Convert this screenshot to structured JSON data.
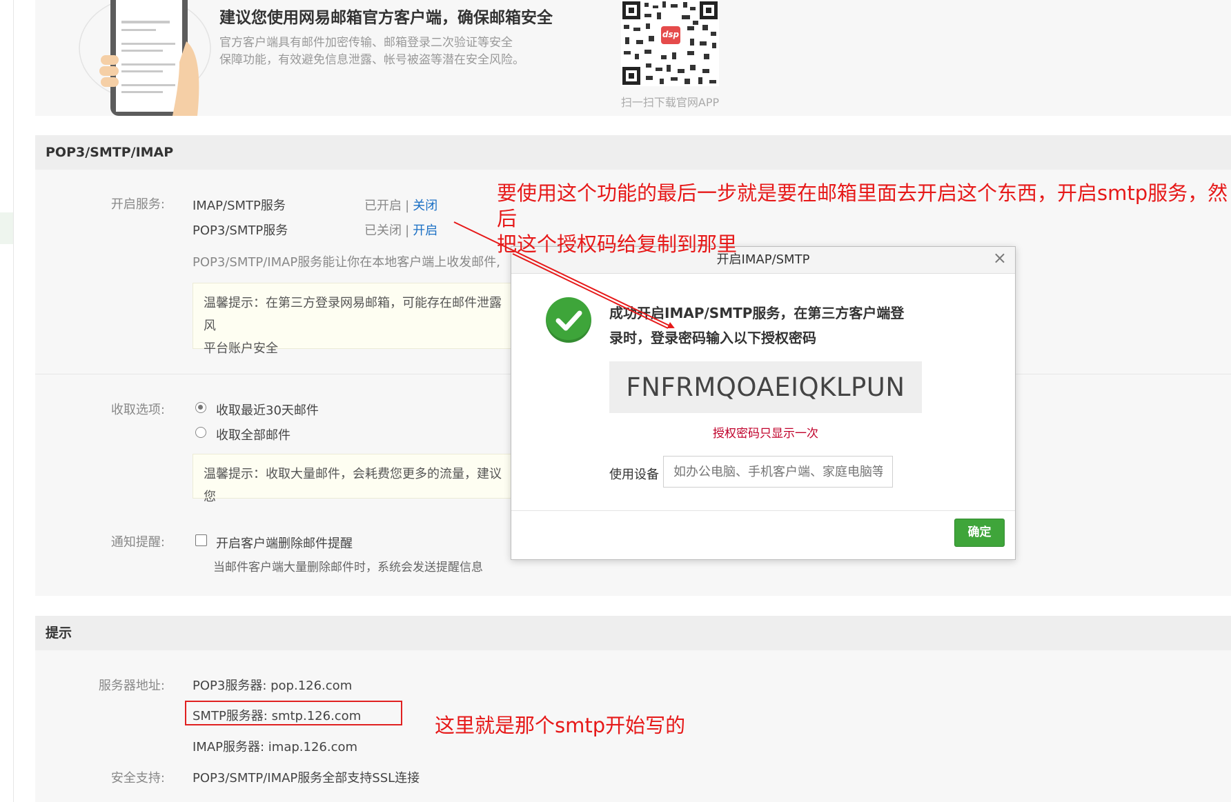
{
  "top_banner": {
    "title": "建议您使用网易邮箱官方客户端，确保邮箱安全",
    "desc_line1": "官方客户端具有邮件加密传输、邮箱登录二次验证等安全",
    "desc_line2": "保障功能，有效避免信息泄露、帐号被盗等潜在安全风险。",
    "qr_caption": "扫一扫下载官网APP",
    "qr_logo_text": "dsp"
  },
  "pop_section": {
    "title": "POP3/SMTP/IMAP",
    "service_label": "开启服务:",
    "services": [
      {
        "name": "IMAP/SMTP服务",
        "status": "已开启",
        "sep": "|",
        "action": "关闭"
      },
      {
        "name": "POP3/SMTP服务",
        "status": "已关闭",
        "sep": "|",
        "action": "开启"
      }
    ],
    "service_desc": "POP3/SMTP/IMAP服务能让你在本地客户端上收发邮件,",
    "tip1_line1": "温馨提示：在第三方登录网易邮箱，可能存在邮件泄露风",
    "tip1_line2": "平台账户安全",
    "fetch_label": "收取选项:",
    "fetch_options": [
      {
        "label": "收取最近30天邮件",
        "selected": true
      },
      {
        "label": "收取全部邮件",
        "selected": false
      }
    ],
    "tip2": "温馨提示：收取大量邮件，会耗费您更多的流量，建议您",
    "notify_label": "通知提醒:",
    "notify_checkbox": "开启客户端删除邮件提醒",
    "notify_checked": false,
    "notify_desc": "当邮件客户端大量删除邮件时，系统会发送提醒信息"
  },
  "hint_section": {
    "title": "提示",
    "server_label": "服务器地址:",
    "servers": [
      "POP3服务器: pop.126.com",
      "SMTP服务器: smtp.126.com",
      "IMAP服务器: imap.126.com"
    ],
    "security_label": "安全支持:",
    "security_value": "POP3/SMTP/IMAP服务全部支持SSL连接"
  },
  "modal": {
    "title": "开启IMAP/SMTP",
    "close": "×",
    "success_line1": "成功开启IMAP/SMTP服务，在第三方客户端登",
    "success_line2": "录时，登录密码输入以下授权密码",
    "auth_code": "FNFRMQOAEIQKLPUN",
    "warning": "授权密码只显示一次",
    "device_label": "使用设备",
    "device_placeholder": "如办公电脑、手机客户端、家庭电脑等",
    "confirm": "确定"
  },
  "annotations": {
    "top_line1": "要使用这个功能的最后一步就是要在邮箱里面去开启这个东西，开启smtp服务，然后",
    "top_line2": "把这个授权码给复制到那里",
    "bottom": "这里就是那个smtp开始写的",
    "color": "#e61919"
  },
  "colors": {
    "link": "#1a6fc4",
    "confirm_green": "#3fa53a",
    "warning_red": "#c0002a"
  }
}
